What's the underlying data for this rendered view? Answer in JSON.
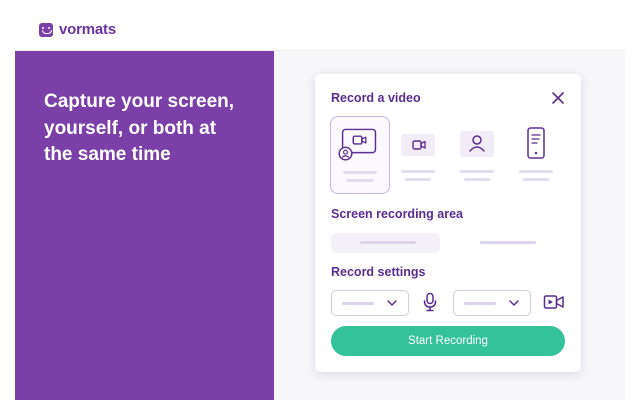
{
  "brand": {
    "name": "vormats",
    "color": "#7b3fa8"
  },
  "hero": {
    "title": "Capture your screen, yourself, or both at the same time",
    "background": "#7b3fa8"
  },
  "card": {
    "title": "Record a video",
    "close_icon": "close-icon",
    "modes": [
      {
        "icon": "screen-and-camera-icon",
        "selected": true
      },
      {
        "icon": "screen-icon",
        "selected": false
      },
      {
        "icon": "person-icon",
        "selected": false
      },
      {
        "icon": "phone-icon",
        "selected": false
      }
    ],
    "area_label": "Screen recording area",
    "settings_label": "Record settings",
    "mic_icon": "microphone-icon",
    "camera_icon": "camera-icon",
    "start_button": "Start Recording"
  },
  "colors": {
    "accent": "#34c29a",
    "heading": "#5b2d90"
  }
}
